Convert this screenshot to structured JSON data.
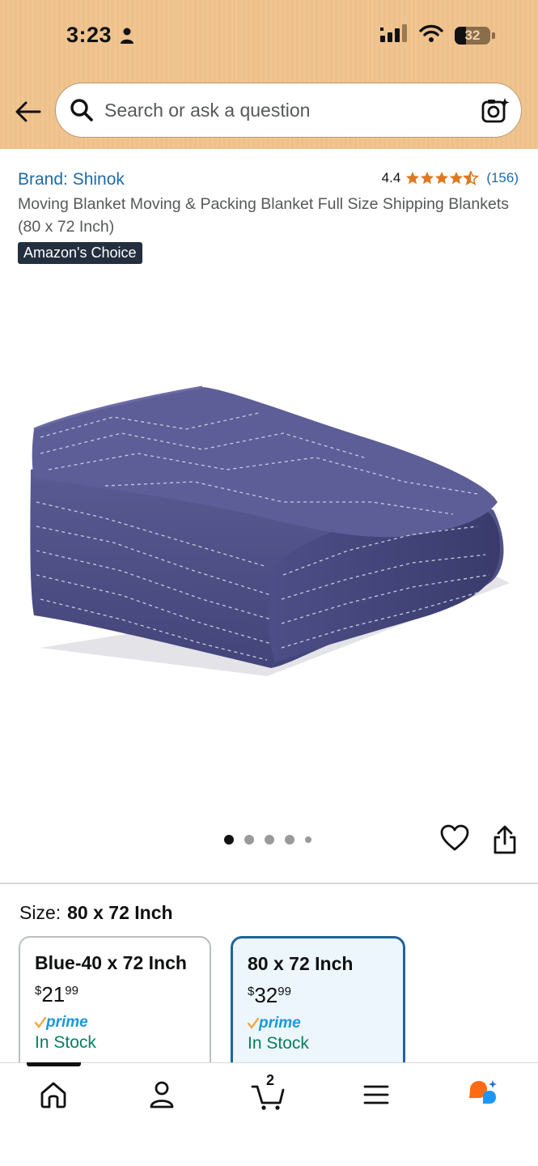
{
  "status_bar": {
    "time": "3:23",
    "battery": "32"
  },
  "search": {
    "placeholder": "Search or ask a question"
  },
  "product": {
    "brand": "Brand: Shinok",
    "rating_score": "4.4",
    "rating_count": "(156)",
    "title": "Moving Blanket Moving & Packing Blanket Full Size Shipping Blankets (80 x 72 Inch)",
    "badge": "Amazon's Choice"
  },
  "size": {
    "label": "Size:",
    "selected_value": "80 x 72 Inch",
    "options": [
      {
        "name": "Blue-40 x 72 Inch",
        "currency": "$",
        "price_whole": "21",
        "price_cents": "99",
        "prime": "prime",
        "stock": "In Stock"
      },
      {
        "name": "80 x 72 Inch",
        "currency": "$",
        "price_whole": "32",
        "price_cents": "99",
        "prime": "prime",
        "stock": "In Stock"
      }
    ]
  },
  "bottom_nav": {
    "cart_count": "2"
  },
  "colors": {
    "header_bg": "#f0c592",
    "link_blue": "#1e6aa8",
    "star_orange": "#de7921",
    "badge_navy": "#232f3e",
    "stock_green": "#067d62",
    "selected_border": "#2162a1"
  }
}
